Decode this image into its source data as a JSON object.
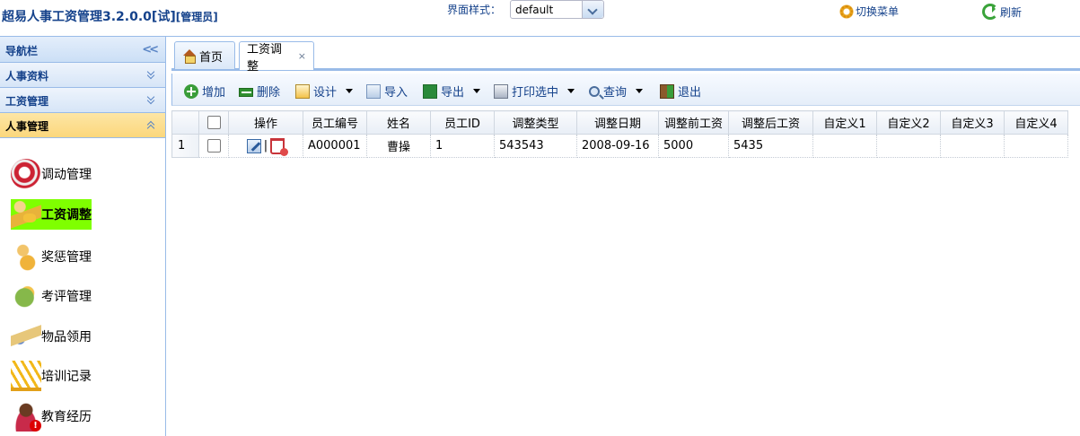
{
  "header": {
    "title": "超易人事工资管理3.2.0.0[试]",
    "role": "[管理员]",
    "style_label": "界面样式：",
    "style_value": "default",
    "switch_menu": "切换菜单",
    "refresh": "刷新"
  },
  "sidebar": {
    "title": "导航栏",
    "sections": [
      {
        "label": "人事资料",
        "active": false
      },
      {
        "label": "工资管理",
        "active": false
      },
      {
        "label": "人事管理",
        "active": true
      }
    ],
    "items": [
      {
        "label": "调动管理",
        "icon": "transfer-icon",
        "selected": false
      },
      {
        "label": "工资调整",
        "icon": "salary-adjust-icon",
        "selected": true
      },
      {
        "label": "奖惩管理",
        "icon": "reward-icon",
        "selected": false
      },
      {
        "label": "考评管理",
        "icon": "review-icon",
        "selected": false
      },
      {
        "label": "物品领用",
        "icon": "goods-icon",
        "selected": false
      },
      {
        "label": "培训记录",
        "icon": "training-icon",
        "selected": false
      },
      {
        "label": "教育经历",
        "icon": "education-icon",
        "selected": false
      }
    ]
  },
  "tabs": [
    {
      "label": "首页",
      "icon": "home-icon",
      "active": false
    },
    {
      "label": "工资调整",
      "active": true,
      "closable": true,
      "close_glyph": "×"
    }
  ],
  "toolbar": {
    "add": "增加",
    "delete": "删除",
    "design": "设计",
    "import": "导入",
    "export": "导出",
    "print_selected": "打印选中",
    "query": "查询",
    "exit": "退出"
  },
  "grid": {
    "columns": [
      "操作",
      "员工编号",
      "姓名",
      "员工ID",
      "调整类型",
      "调整日期",
      "调整前工资",
      "调整后工资",
      "自定义1",
      "自定义2",
      "自定义3",
      "自定义4"
    ],
    "rows": [
      {
        "num": "1",
        "emp_no": "A000001",
        "name": "曹操",
        "emp_id": "1",
        "adjust_type": "543543",
        "adjust_date": "2008-09-16",
        "before": "5000",
        "after": "5435",
        "c1": "",
        "c2": "",
        "c3": "",
        "c4": ""
      }
    ],
    "op_separator": "|"
  }
}
